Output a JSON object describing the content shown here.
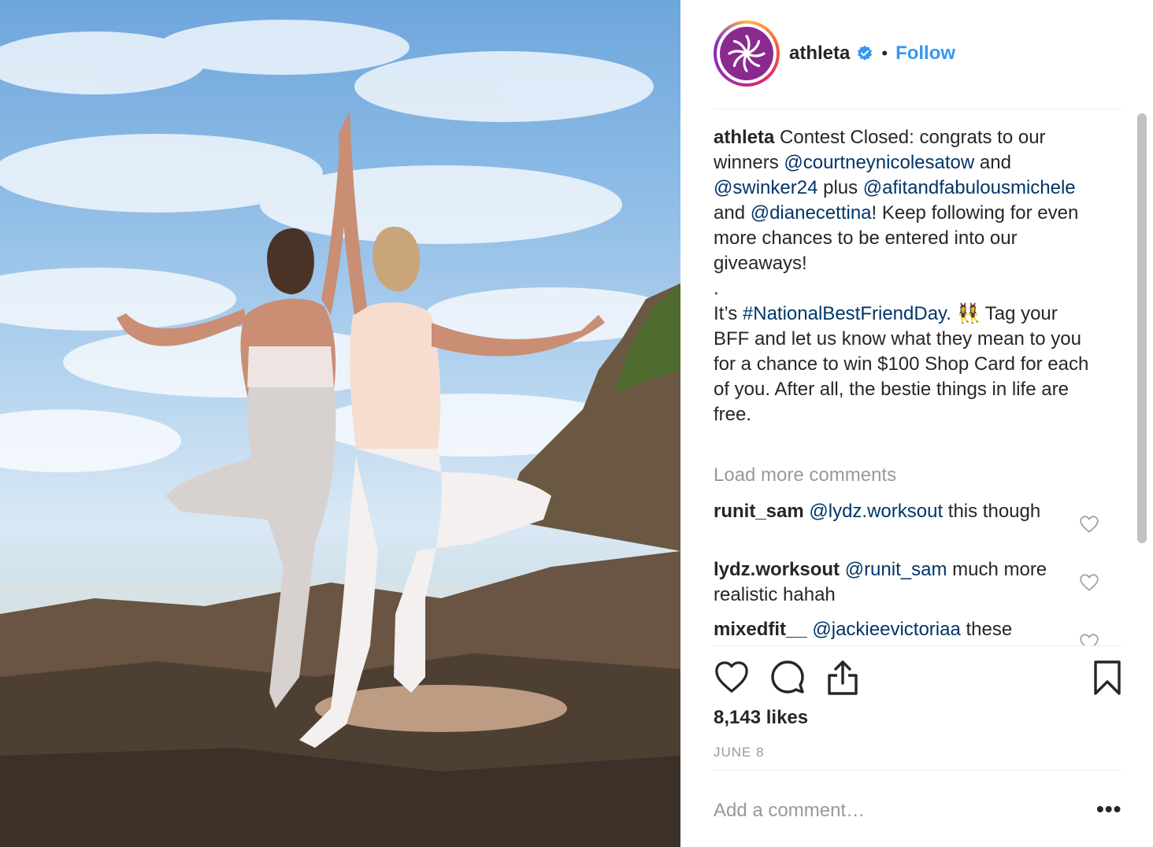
{
  "post": {
    "image_alt": "Two women doing tree yoga pose back to back on a rocky beach",
    "username": "athleta",
    "verified": true,
    "header_dot": "•",
    "follow_label": "Follow"
  },
  "caption": {
    "user": "athleta",
    "t1": " Contest Closed: congrats to our winners ",
    "m1": "@courtneynicolesatow",
    "t2": " and ",
    "m2": "@swinker24",
    "t3": " plus ",
    "m3": "@afitandfabulousmichele",
    "t4": " and ",
    "m4": "@dianecettina",
    "t5": "! Keep following for even more chances to be entered into our giveaways!",
    "t6": ".",
    "t7": "It’s ",
    "hashtag": "#NationalBestFriendDay",
    "t8": ". 👯‍♀️ Tag your BFF and let us know what they mean to you for a chance to win $100 Shop Card for each of you. After all, the bestie things in life are free."
  },
  "load_more": "Load more comments",
  "comments": [
    {
      "user": "runit_sam",
      "mention": "@lydz.worksout",
      "text": " this though"
    },
    {
      "user": "lydz.worksout",
      "mention": "@runit_sam",
      "text": " much more realistic hahah"
    },
    {
      "user": "mixedfit__",
      "mention": "@jackieevictoriaa",
      "text": " these"
    }
  ],
  "likes": "8,143 likes",
  "date": "JUNE 8",
  "add_comment_placeholder": "Add a comment…",
  "more_options": "•••",
  "colors": {
    "link": "#003569",
    "follow": "#3897f0",
    "muted": "#999999",
    "brand": "#8a2a8f"
  }
}
